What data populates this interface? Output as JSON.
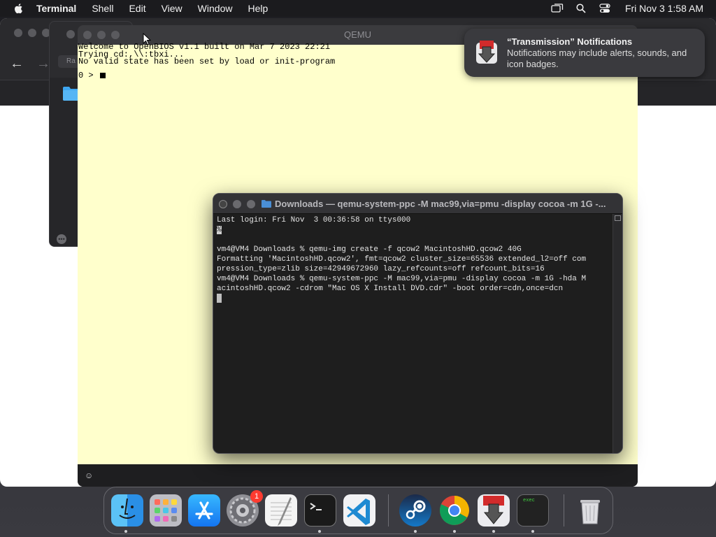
{
  "menubar": {
    "app_name": "Terminal",
    "menus": [
      "Shell",
      "Edit",
      "View",
      "Window",
      "Help"
    ],
    "clock": "Fri Nov 3  1:58 AM"
  },
  "finder2": {
    "rar_label": "Ra"
  },
  "qemu": {
    "title": "QEMU",
    "lines": [
      "Welcome to OpenBIOS v1.1 built on Mar 7 2023 22:21",
      "Trying cd:,\\\\:tbxi...",
      "No valid state has been set by load or init-program",
      "0 > "
    ]
  },
  "notification": {
    "title": "“Transmission” Notifications",
    "body": "Notifications may include alerts, sounds, and icon badges."
  },
  "terminal": {
    "title": "Downloads — qemu-system-ppc -M mac99,via=pmu -display cocoa -m 1G -...",
    "lines": [
      "Last login: Fri Nov  3 00:36:58 on ttys000",
      "%",
      "",
      "vm4@VM4 Downloads % qemu-img create -f qcow2 MacintoshHD.qcow2 40G",
      "Formatting 'MacintoshHD.qcow2', fmt=qcow2 cluster_size=65536 extended_l2=off com",
      "pression_type=zlib size=42949672960 lazy_refcounts=off refcount_bits=16",
      "vm4@VM4 Downloads % qemu-system-ppc -M mac99,via=pmu -display cocoa -m 1G -hda M",
      "acintoshHD.qcow2 -cdrom \"Mac OS X Install DVD.cdr\" -boot order=cdn,once=dcn"
    ]
  },
  "dock": {
    "items": [
      {
        "name": "finder",
        "icon": "finder-icon"
      },
      {
        "name": "launchpad",
        "icon": "launchpad-icon"
      },
      {
        "name": "app-store",
        "icon": "app-store-icon"
      },
      {
        "name": "system-settings",
        "icon": "settings-icon",
        "badge": "1"
      },
      {
        "name": "textedit",
        "icon": "textedit-icon"
      },
      {
        "name": "terminal",
        "icon": "terminal-icon"
      },
      {
        "name": "vscode",
        "icon": "vscode-icon"
      },
      {
        "name": "steam",
        "icon": "steam-icon"
      },
      {
        "name": "chrome",
        "icon": "chrome-icon"
      },
      {
        "name": "transmission",
        "icon": "transmission-icon"
      },
      {
        "name": "exec",
        "icon": "exec-icon",
        "label": "exec"
      },
      {
        "name": "trash",
        "icon": "trash-icon"
      }
    ]
  },
  "colors": {
    "qemu_screen": "#ffffcc",
    "terminal_bg": "#1e1e1e",
    "badge": "#ff3b30"
  }
}
